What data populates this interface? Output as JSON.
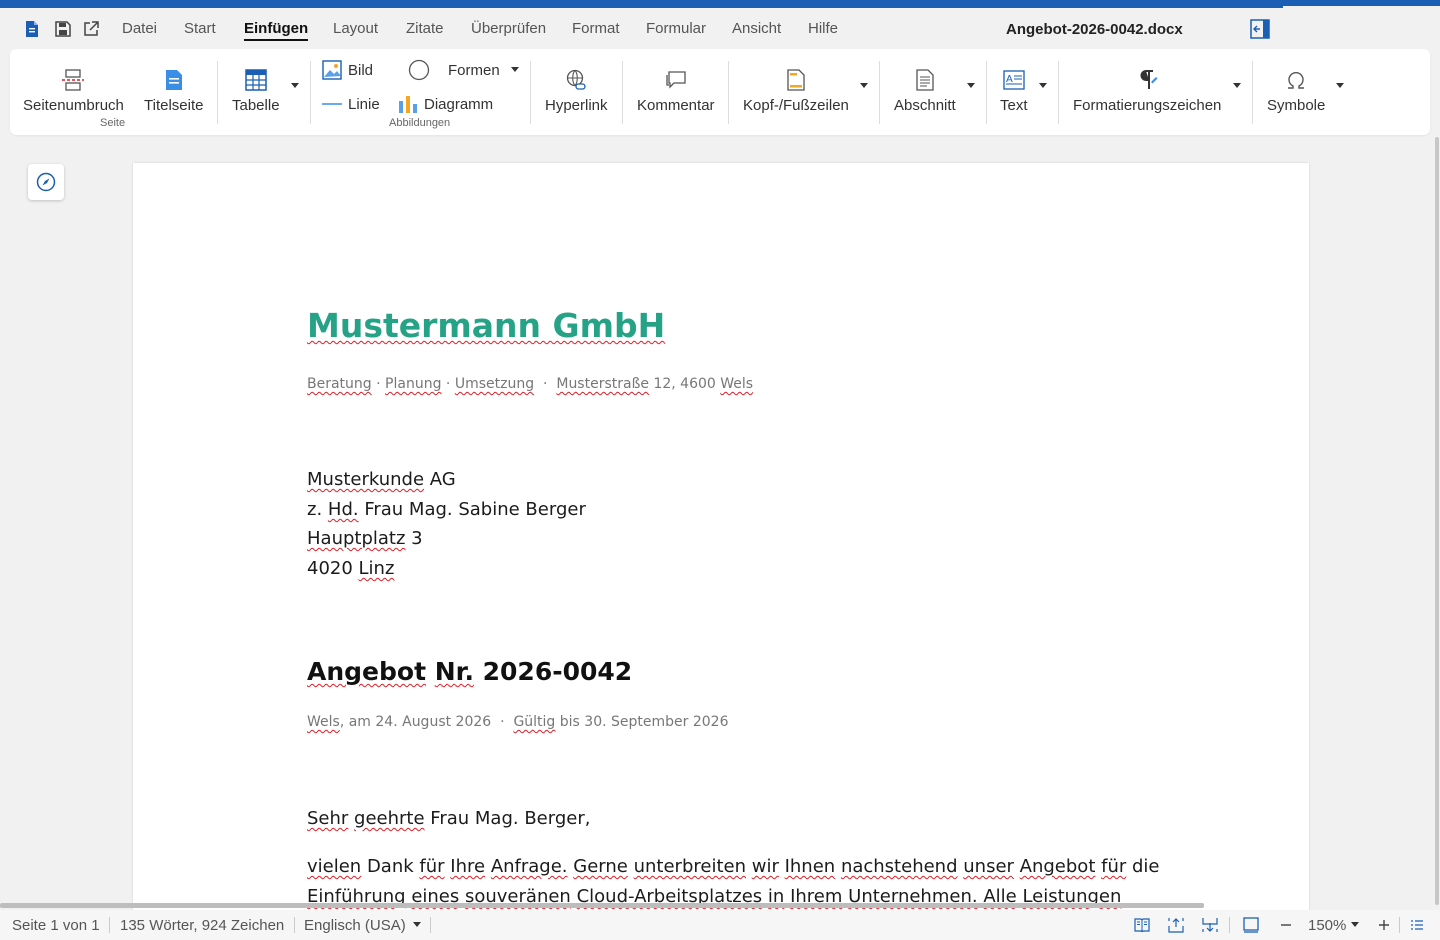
{
  "window": {
    "title": "Angebot-2026-0042.docx"
  },
  "menu": {
    "items": [
      "Datei",
      "Start",
      "Einfügen",
      "Layout",
      "Zitate",
      "Überprüfen",
      "Format",
      "Formular",
      "Ansicht",
      "Hilfe"
    ],
    "active": "Einfügen"
  },
  "ribbon": {
    "page_break": "Seitenumbruch",
    "title_page": "Titelseite",
    "group_page": "Seite",
    "table": "Tabelle",
    "image": "Bild",
    "shapes": "Formen",
    "line": "Linie",
    "chart": "Diagramm",
    "group_images": "Abbildungen",
    "hyperlink": "Hyperlink",
    "comment": "Kommentar",
    "header_footer": "Kopf-/Fußzeilen",
    "section": "Abschnitt",
    "text": "Text",
    "formatting_marks": "Formatierungszeichen",
    "symbols": "Symbole"
  },
  "document": {
    "company": "Mustermann GmbH",
    "tagline": {
      "w1": "Beratung",
      "d1": " · ",
      "w2": "Planung",
      "d2": " · ",
      "w3": "Umsetzung",
      "d3": "  ·  ",
      "w4": "Musterstraße",
      "w5": " 12, 4600 ",
      "w6": "Wels"
    },
    "recipient": {
      "l1a": "Musterkunde",
      "l1b": " AG",
      "l2a": "z. ",
      "l2b": "Hd.",
      "l2c": " Frau Mag. Sabine Berger",
      "l3a": "Hauptplatz",
      "l3b": " 3",
      "l4a": "4020 ",
      "l4b": "Linz"
    },
    "offer": {
      "a": "Angebot",
      "b": " ",
      "c": "Nr.",
      "d": " 2026-0042"
    },
    "dateline": {
      "a": "Wels",
      "b": ", am 24. August 2026  ·  ",
      "c": "Gültig",
      "d": " bis 30. September 2026"
    },
    "salutation": {
      "a": "Sehr",
      "b": " ",
      "c": "geehrte",
      "d": " Frau Mag. Berger,"
    },
    "para1": {
      "a": "vielen",
      "b": " Dank ",
      "c": "für",
      "d": " ",
      "e": "Ihre",
      "f": " ",
      "g": "Anfrage.",
      "h": " ",
      "i": "Gerne",
      "j": " ",
      "k": "unterbreiten",
      "l": " ",
      "m": "wir",
      "n": " ",
      "o": "Ihnen",
      "p": " ",
      "q": "nachstehend",
      "r": " ",
      "s": "unser",
      "t": " ",
      "u": "Angebot",
      "v": " ",
      "w": "für",
      "x": " die"
    },
    "para1_line2": {
      "a": "Einführung",
      "b": " ",
      "c": "eines",
      "d": " ",
      "e": "souveränen",
      "f": " ",
      "g": "Cloud-Arbeitsplatzes",
      "h": " ",
      "i": "in",
      "j": " ",
      "k": "Ihrem",
      "l": " ",
      "m": "Unternehmen.",
      "n": " ",
      "o": "Alle",
      "p": " ",
      "q": "Leistungen"
    }
  },
  "statusbar": {
    "page": "Seite 1 von 1",
    "counts": "135 Wörter, 924 Zeichen",
    "language": "Englisch (USA)",
    "zoom": "150%"
  },
  "colors": {
    "accent": "#1a5fb4",
    "company": "#26a387",
    "spellcheck": "#e01b24"
  }
}
